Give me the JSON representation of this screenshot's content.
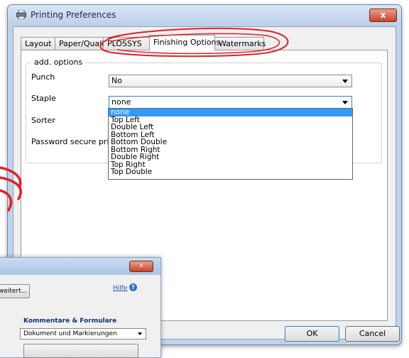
{
  "window": {
    "title": "Printing Preferences",
    "close_label": "x"
  },
  "tabs": [
    "Layout",
    "Paper/Quality",
    "PLOSSYS",
    "Finishing Options",
    "Watermarks"
  ],
  "active_tab": "Finishing Options",
  "group": {
    "title": "add. options",
    "labels": {
      "punch": "Punch",
      "staple": "Staple",
      "sorter": "Sorter",
      "password": "Password secure print"
    },
    "punch_value": "No",
    "staple_value": "none",
    "staple_options": [
      "none",
      "Top Left",
      "Double Left",
      "Bottom Left",
      "Bottom Double",
      "Bottom Right",
      "Double Right",
      "Top Right",
      "Top Double"
    ]
  },
  "buttons": {
    "ok": "OK",
    "cancel": "Cancel"
  },
  "background_window": {
    "button_label": "weitert...",
    "help_label": "Hilfe",
    "section_label": "Kommentare & Formulare",
    "select_value": "Dokument und Markierungen"
  },
  "colors": {
    "annotation": "#e0202a",
    "selection": "#3399ff"
  }
}
